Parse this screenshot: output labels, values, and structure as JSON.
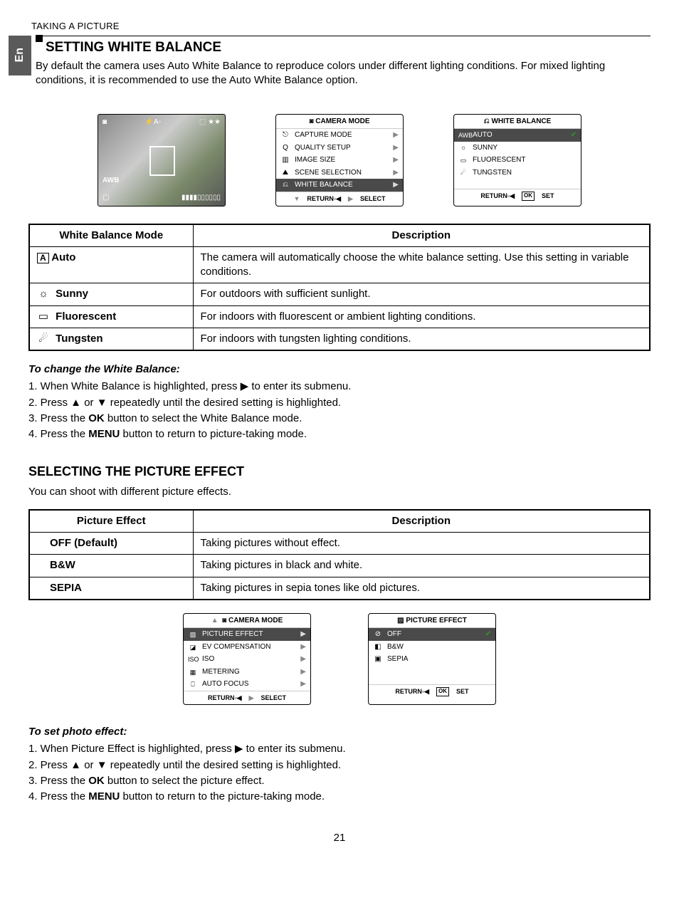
{
  "header": "TAKING A PICTURE",
  "lang_tab": "En",
  "section1": {
    "title": "SETTING WHITE BALANCE",
    "intro": "By default the camera uses Auto White Balance to reproduce colors under different lighting conditions. For mixed lighting conditions, it is recommended to use the Auto White Balance option."
  },
  "camera_menu": {
    "title": "CAMERA MODE",
    "items": [
      {
        "icon": "⎋",
        "label": "CAPTURE MODE"
      },
      {
        "icon": "Q",
        "label": "QUALITY SETUP"
      },
      {
        "icon": "▥",
        "label": "IMAGE SIZE"
      },
      {
        "icon": "⛰",
        "label": "SCENE SELECTION"
      },
      {
        "icon": "⎌",
        "label": "WHITE BALANCE",
        "selected": true
      }
    ],
    "footer_down": "▼",
    "footer_return": "RETURN",
    "footer_select": "SELECT"
  },
  "wb_menu": {
    "title": "WHITE BALANCE",
    "items": [
      {
        "icon": "AWB",
        "label": "AUTO",
        "selected": true,
        "check": true
      },
      {
        "icon": "☼",
        "label": "SUNNY"
      },
      {
        "icon": "▭",
        "label": "FLUORESCENT"
      },
      {
        "icon": "☄",
        "label": "TUNGSTEN"
      }
    ],
    "footer_return": "RETURN",
    "footer_set": "SET",
    "ok": "OK"
  },
  "preview": {
    "top_left": "◙",
    "top_mid": "⚡A◦",
    "top_right": "⬚ ★★",
    "awb": "AWB",
    "bottom_left": "▢",
    "bottom_right": "▮▮▮▮▯▯▯▯▯▯"
  },
  "wb_table": {
    "headers": [
      "White Balance Mode",
      "Description"
    ],
    "rows": [
      {
        "icon": "A",
        "mode": "Auto",
        "desc": "The camera will automatically choose the white balance setting. Use this setting in variable conditions."
      },
      {
        "icon": "☼",
        "mode": "Sunny",
        "desc": "For outdoors with sufficient sunlight."
      },
      {
        "icon": "▭",
        "mode": "Fluorescent",
        "desc": "For indoors with fluorescent or ambient lighting conditions."
      },
      {
        "icon": "☄",
        "mode": "Tungsten",
        "desc": "For indoors with tungsten lighting conditions."
      }
    ]
  },
  "wb_steps": {
    "title": "To change the White Balance:",
    "items": [
      "When White Balance is highlighted, press  ▶  to enter its submenu.",
      "Press ▲  or  ▼  repeatedly until the desired setting is highlighted.",
      "Press the OK button to select the White Balance mode.",
      "Press the MENU button to return to picture-taking mode."
    ]
  },
  "section2": {
    "title": "SELECTING THE PICTURE EFFECT",
    "intro": "You can shoot with different picture effects."
  },
  "pe_table": {
    "headers": [
      "Picture Effect",
      "Description"
    ],
    "rows": [
      {
        "mode": "OFF  (Default)",
        "desc": "Taking pictures without effect."
      },
      {
        "mode": "B&W",
        "desc": "Taking pictures in black and white."
      },
      {
        "mode": "SEPIA",
        "desc": "Taking pictures in sepia tones like old pictures."
      }
    ]
  },
  "camera_menu2": {
    "title": "CAMERA MODE",
    "up": "▲",
    "items": [
      {
        "icon": "▨",
        "label": "PICTURE EFFECT",
        "selected": true
      },
      {
        "icon": "◪",
        "label": "EV COMPENSATION"
      },
      {
        "icon": "ISO",
        "label": "ISO"
      },
      {
        "icon": "▦",
        "label": "METERING"
      },
      {
        "icon": "⎕",
        "label": "AUTO FOCUS"
      }
    ],
    "footer_return": "RETURN",
    "footer_select": "SELECT"
  },
  "pe_menu": {
    "title": "PICTURE EFFECT",
    "items": [
      {
        "icon": "⊘",
        "label": "OFF",
        "selected": true,
        "check": true
      },
      {
        "icon": "◧",
        "label": "B&W"
      },
      {
        "icon": "▣",
        "label": "SEPIA"
      }
    ],
    "footer_return": "RETURN",
    "footer_set": "SET",
    "ok": "OK"
  },
  "pe_steps": {
    "title": "To set photo effect:",
    "items": [
      "When Picture Effect is highlighted, press  ▶  to enter its submenu.",
      "Press ▲  or  ▼  repeatedly until the desired setting is highlighted.",
      "Press the OK button to select the picture effect.",
      "Press the MENU button to return to the picture-taking mode."
    ]
  },
  "page_number": "21"
}
